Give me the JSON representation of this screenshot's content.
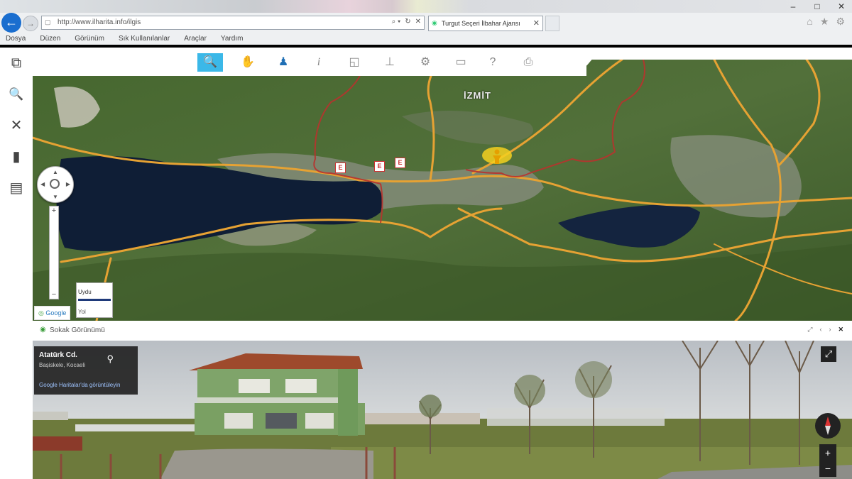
{
  "browser": {
    "url": "http://www.ilharita.info/ilgis",
    "tab_title": "Turgut Seçeri İlbahar Ajansı",
    "menu": [
      "Dosya",
      "Düzen",
      "Görünüm",
      "Sık Kullanılanlar",
      "Araçlar",
      "Yardım"
    ],
    "window_controls": [
      "–",
      "□",
      "✕"
    ],
    "right_icons": [
      "⌂",
      "★",
      "⚙"
    ]
  },
  "left_tools": [
    {
      "name": "layers-icon",
      "glyph": "⧉"
    },
    {
      "name": "search-icon",
      "glyph": "🔍"
    },
    {
      "name": "tools-icon",
      "glyph": "✕"
    },
    {
      "name": "bookmark-icon",
      "glyph": "▮"
    },
    {
      "name": "document-icon",
      "glyph": "▤"
    }
  ],
  "map_toolbar": [
    {
      "name": "search-tool-icon",
      "glyph": "🔍"
    },
    {
      "name": "pan-hand-icon",
      "glyph": "✋"
    },
    {
      "name": "street-view-person-icon",
      "glyph": "♟"
    },
    {
      "name": "info-icon",
      "glyph": "i"
    },
    {
      "name": "select-area-icon",
      "glyph": "◱"
    },
    {
      "name": "stamp-icon",
      "glyph": "⊥"
    },
    {
      "name": "settings-icon",
      "glyph": "⚙"
    },
    {
      "name": "measure-icon",
      "glyph": "▭"
    },
    {
      "name": "help-icon",
      "glyph": "?"
    },
    {
      "name": "print-icon",
      "glyph": "⎙"
    }
  ],
  "map": {
    "city_label": "İZMİT",
    "markers": [
      "E",
      "E",
      "E"
    ],
    "layer_options": [
      "Uydu",
      "Yol"
    ],
    "credit": "Google"
  },
  "street_view": {
    "header": "Sokak Görünümü",
    "header_controls": [
      "⤢",
      "‹",
      "›",
      "✕"
    ],
    "info_title": "Atatürk Cd.",
    "info_subtitle": "Başiskele, Kocaeli",
    "info_link": "Google Haritalar'da görüntüleyin",
    "zoom_in": "+",
    "zoom_out": "−"
  },
  "colors": {
    "tool_active": "#3bb8e8",
    "road": "#e6a233",
    "boundary": "#b8322d",
    "water": "#0f1e36",
    "forest": "#3e5c2c"
  }
}
